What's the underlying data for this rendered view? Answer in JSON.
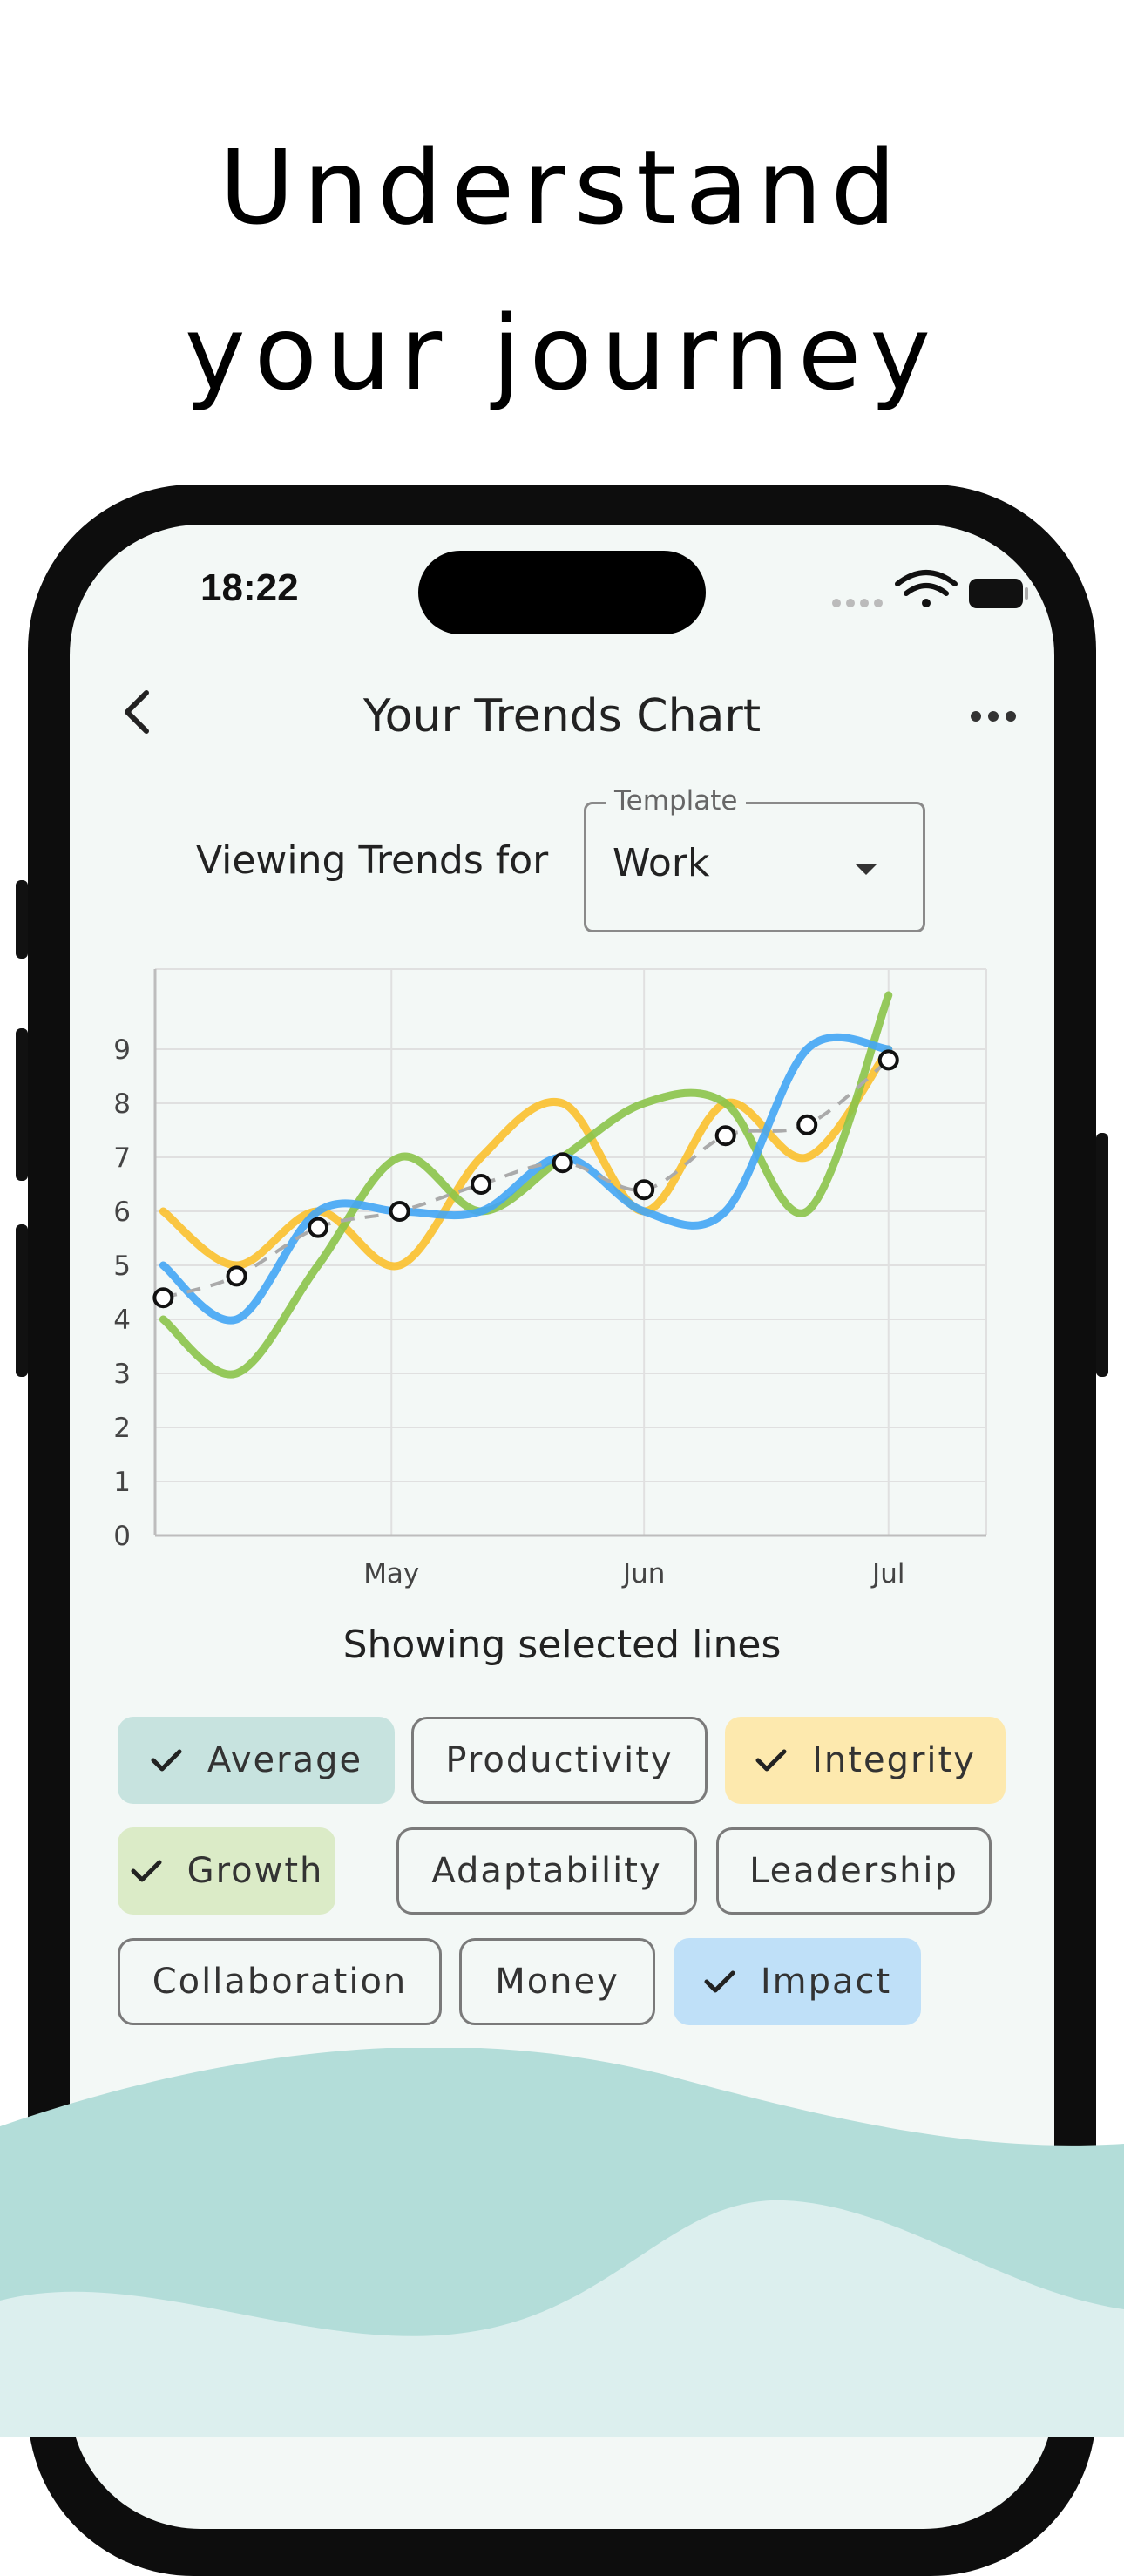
{
  "headline": {
    "line1": "Understand",
    "line2": "your journey"
  },
  "status_bar": {
    "time": "18:22",
    "icons": [
      "signal-icon",
      "wifi-icon",
      "battery-icon"
    ]
  },
  "nav": {
    "title": "Your Trends Chart",
    "back_icon": "chevron-left-icon",
    "more_icon": "more-horizontal-icon"
  },
  "filter": {
    "label": "Viewing Trends for",
    "template_label": "Template",
    "template_value": "Work"
  },
  "chart_caption": "Showing selected lines",
  "chips": [
    {
      "label": "Average",
      "selected": true,
      "color": "#c7e3df"
    },
    {
      "label": "Productivity",
      "selected": false,
      "color": "#f3f8f6"
    },
    {
      "label": "Integrity",
      "selected": true,
      "color": "#fde9ae"
    },
    {
      "label": "Growth",
      "selected": true,
      "color": "#dbebc7"
    },
    {
      "label": "Adaptability",
      "selected": false,
      "color": "#f3f8f6"
    },
    {
      "label": "Leadership",
      "selected": false,
      "color": "#f3f8f6"
    },
    {
      "label": "Collaboration",
      "selected": false,
      "color": "#f3f8f6"
    },
    {
      "label": "Money",
      "selected": false,
      "color": "#f3f8f6"
    },
    {
      "label": "Impact",
      "selected": true,
      "color": "#bfe0f8"
    }
  ],
  "chart_data": {
    "type": "line",
    "x_tick_labels": [
      "May",
      "Jun",
      "Jul"
    ],
    "x_tick_positions": [
      2.9,
      6.0,
      9.0
    ],
    "ylim": [
      0,
      10
    ],
    "yticks": [
      0,
      1,
      2,
      3,
      4,
      5,
      6,
      7,
      8,
      9
    ],
    "grid": true,
    "series": [
      {
        "name": "Integrity",
        "color": "#fbc02d",
        "x": [
          0.1,
          1.0,
          2.0,
          3.0,
          4.0,
          5.0,
          6.0,
          7.0,
          8.0,
          9.0
        ],
        "y": [
          6,
          5,
          6,
          5,
          7,
          8,
          6,
          8,
          7,
          9
        ]
      },
      {
        "name": "Growth",
        "color": "#8bc34a",
        "x": [
          0.1,
          1.0,
          2.0,
          3.0,
          4.0,
          5.0,
          6.0,
          7.0,
          8.0,
          9.0
        ],
        "y": [
          4,
          3,
          5,
          7,
          6,
          7,
          8,
          8,
          6,
          10
        ]
      },
      {
        "name": "Impact",
        "color": "#42a5f5",
        "x": [
          0.1,
          1.0,
          2.0,
          3.0,
          4.0,
          5.0,
          6.0,
          7.0,
          8.0,
          9.0
        ],
        "y": [
          5,
          4,
          6,
          6,
          6,
          7,
          6,
          6,
          9,
          9
        ]
      },
      {
        "name": "Average",
        "color": "#aaaaaa",
        "dashed": true,
        "markers": true,
        "x": [
          0.1,
          1.0,
          2.0,
          3.0,
          4.0,
          5.0,
          6.0,
          7.0,
          8.0,
          9.0
        ],
        "y": [
          4.4,
          4.8,
          5.7,
          6.0,
          6.5,
          6.9,
          6.4,
          7.4,
          7.6,
          8.8
        ]
      }
    ]
  }
}
